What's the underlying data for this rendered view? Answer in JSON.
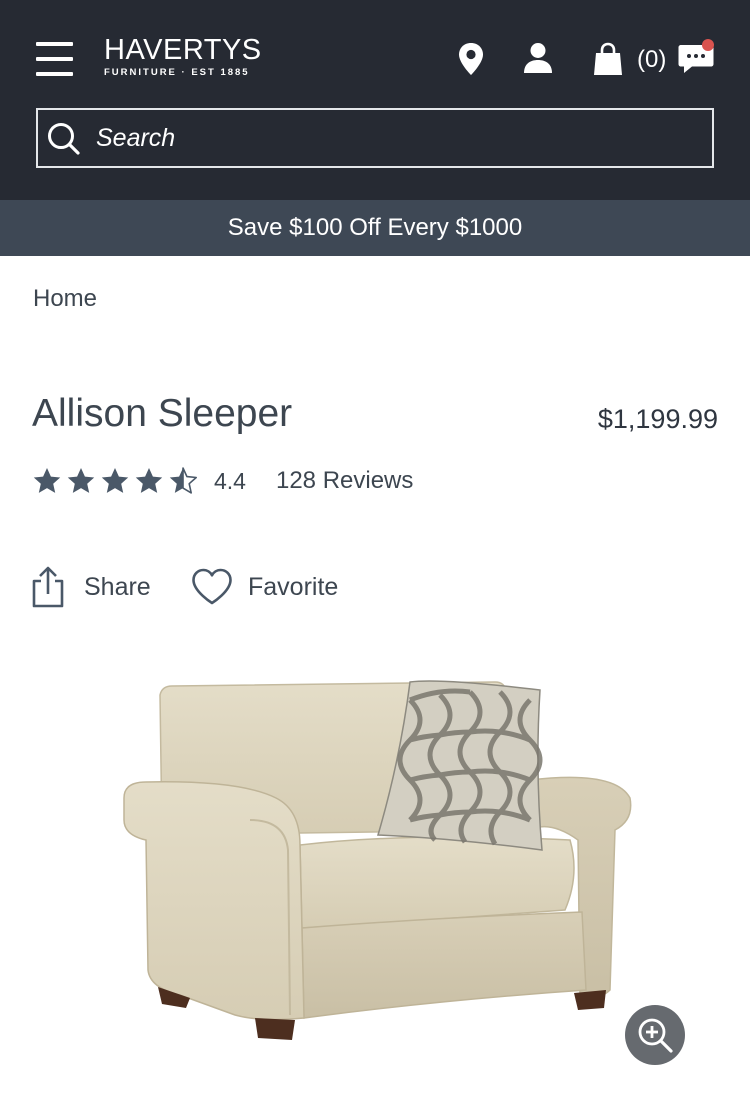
{
  "header": {
    "logo": {
      "name": "HAVERTYS",
      "tagline": "FURNITURE · EST 1885"
    },
    "cart_count": "(0)",
    "icons": [
      "menu-icon",
      "location-pin-icon",
      "account-icon",
      "shopping-bag-icon",
      "chat-icon"
    ],
    "search": {
      "placeholder": "Search",
      "value": ""
    }
  },
  "promo": {
    "text": "Save $100 Off Every $1000"
  },
  "breadcrumb": {
    "home": "Home"
  },
  "product": {
    "title": "Allison Sleeper",
    "price": "$1,199.99",
    "rating": {
      "value": "4.4",
      "stars": 4.4,
      "max_stars": 5,
      "reviews_label": "128 Reviews"
    },
    "actions": {
      "share_label": "Share",
      "favorite_label": "Favorite"
    }
  },
  "colors": {
    "header_bg": "#262a33",
    "promo_bg": "#3e4855",
    "text": "#3d4650",
    "star": "#4a5868",
    "chat_badge": "#d9534f",
    "zoom_button": "#666a6f"
  }
}
